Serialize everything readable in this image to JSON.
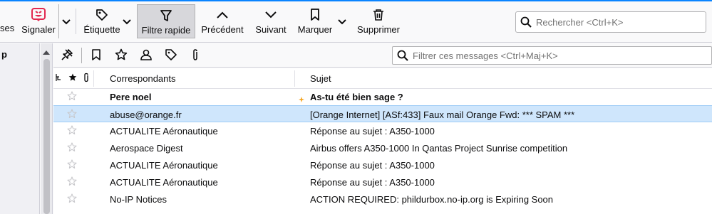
{
  "toolbar": {
    "cut_label": "ses",
    "signaler": "Signaler",
    "etiquette": "Étiquette",
    "filtre_rapide": "Filtre rapide",
    "precedent": "Précédent",
    "suivant": "Suivant",
    "marquer": "Marquer",
    "supprimer": "Supprimer",
    "search_placeholder": "Rechercher <Ctrl+K>"
  },
  "folder_pane": {
    "label": "p"
  },
  "quick_filter": {
    "search_placeholder": "Filtrer ces messages <Ctrl+Maj+K>"
  },
  "columns": {
    "correspondants": "Correspondants",
    "sujet": "Sujet"
  },
  "messages": [
    {
      "from": "Pere noel",
      "subject": "As-tu été bien sage ?",
      "unread": true,
      "selected": false
    },
    {
      "from": "abuse@orange.fr",
      "subject": "[Orange Internet] [ASf:433] Faux mail Orange Fwd: *** SPAM ***",
      "unread": false,
      "selected": true
    },
    {
      "from": "ACTUALITE  Aéronautique",
      "subject": "Réponse au sujet : A350-1000",
      "unread": false,
      "selected": false
    },
    {
      "from": "Aerospace Digest",
      "subject": "Airbus offers A350-1000 In Qantas Project Sunrise competition",
      "unread": false,
      "selected": false
    },
    {
      "from": "ACTUALITE  Aéronautique",
      "subject": "Réponse au sujet : A350-1000",
      "unread": false,
      "selected": false
    },
    {
      "from": "ACTUALITE  Aéronautique",
      "subject": "Réponse au sujet : A350-1000",
      "unread": false,
      "selected": false
    },
    {
      "from": "No-IP Notices",
      "subject": "ACTION REQUIRED: phildurbox.no-ip.org is Expiring Soon",
      "unread": false,
      "selected": false
    }
  ],
  "colors": {
    "accent": "#0a84ff",
    "selected_row": "#cfe6fc",
    "signaler_icon": "#e22850",
    "new_dot": "#f5a623"
  }
}
